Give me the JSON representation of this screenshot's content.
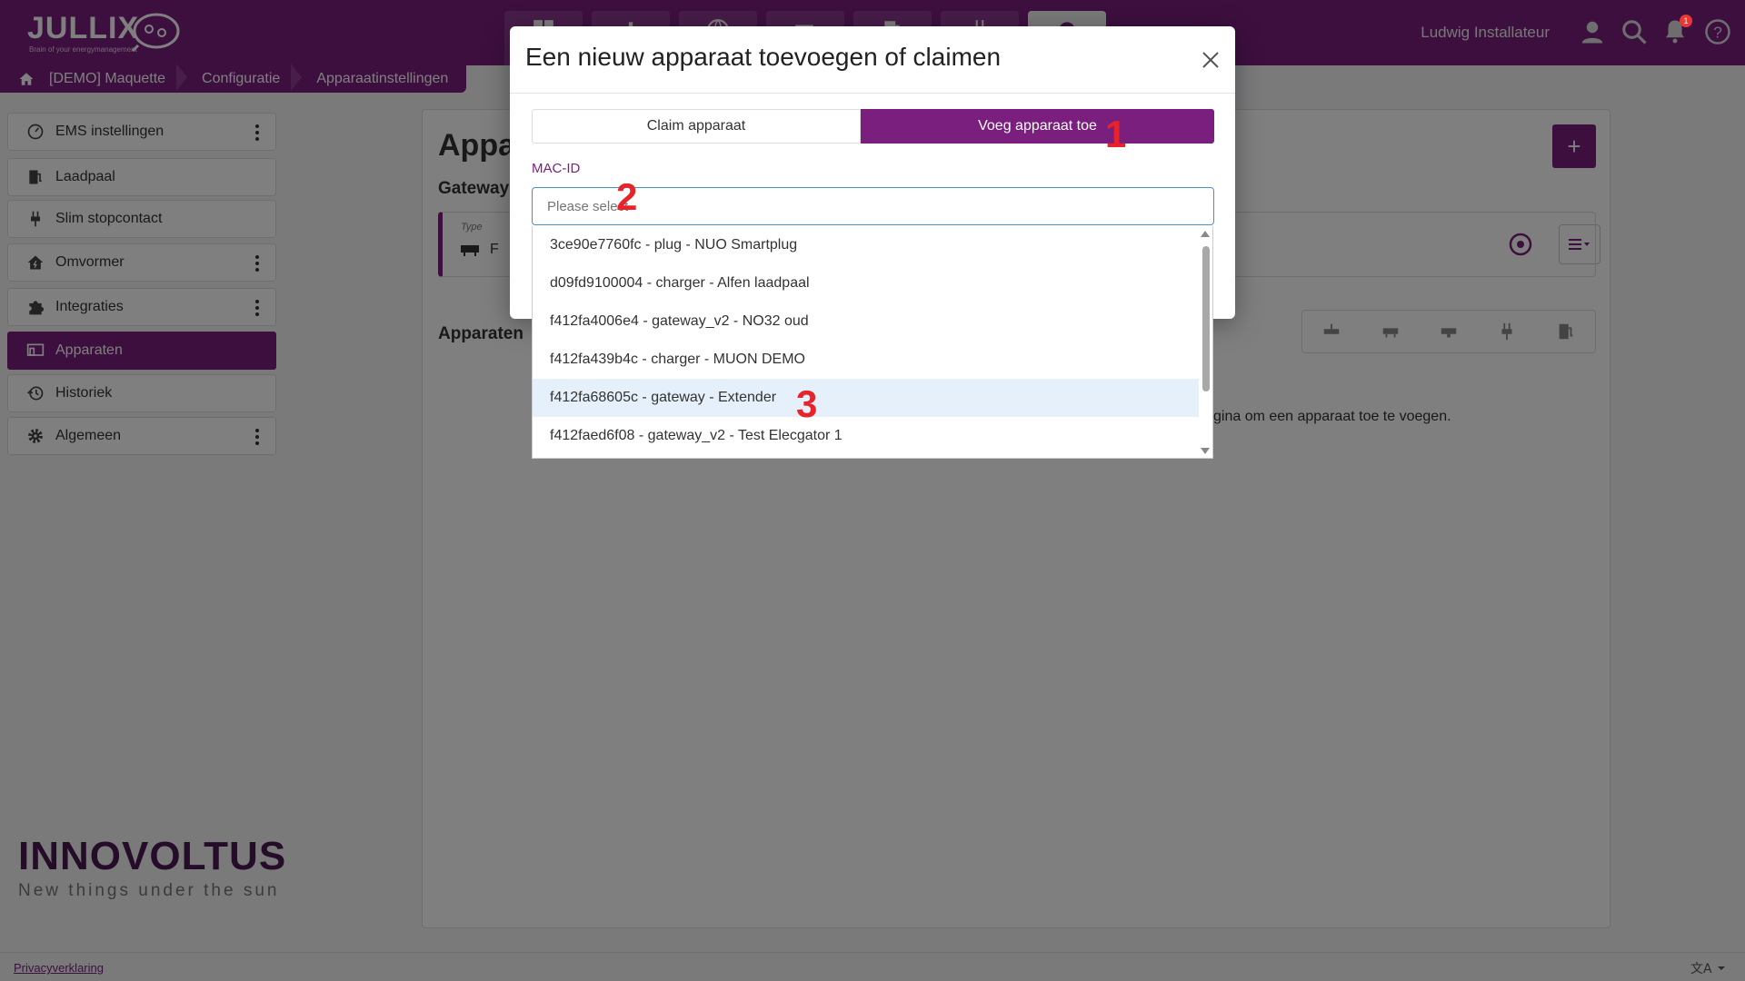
{
  "header": {
    "logo_text": "JULLIX",
    "logo_tagline": "Brain of your energymanagement",
    "user_name": "Ludwig Installateur",
    "notification_count": "1",
    "nav_tabs": [
      "dashboard-icon",
      "chart-icon",
      "globe-icon",
      "battery-icon",
      "charger-icon",
      "plug-icon",
      "settings-icon"
    ]
  },
  "breadcrumb": {
    "items": [
      "[DEMO] Maquette",
      "Configuratie",
      "Apparaatinstellingen"
    ]
  },
  "sidebar": {
    "items": [
      {
        "label": "EMS instellingen",
        "icon": "gauge-icon",
        "menu": true
      },
      {
        "label": "Laadpaal",
        "icon": "charger-icon",
        "menu": false
      },
      {
        "label": "Slim stopcontact",
        "icon": "plug-icon",
        "menu": false
      },
      {
        "label": "Omvormer",
        "icon": "house-bolt-icon",
        "menu": true
      },
      {
        "label": "Integraties",
        "icon": "puzzle-icon",
        "menu": true
      },
      {
        "label": "Apparaten",
        "icon": "devices-icon",
        "menu": false,
        "active": true
      },
      {
        "label": "Historiek",
        "icon": "history-icon",
        "menu": false
      },
      {
        "label": "Algemeen",
        "icon": "gear-icon",
        "menu": true
      }
    ],
    "brand_name": "INNOVOLTUS",
    "brand_tagline": "New things under the sun"
  },
  "main": {
    "title": "Appar",
    "gateway_heading": "Gateway",
    "gateway_type_label": "Type",
    "gateway_type_value": "F",
    "devices_heading": "Apparaten",
    "empty_message": "gina om een apparaat toe te voegen."
  },
  "modal": {
    "title": "Een nieuw apparaat toevoegen of claimen",
    "tab_claim": "Claim apparaat",
    "tab_add": "Voeg apparaat toe",
    "active_tab": "Voeg apparaat toe",
    "field_label": "MAC-ID",
    "placeholder": "Please select"
  },
  "dropdown": {
    "options": [
      "3ce90e7760fc - plug - NUO Smartplug",
      "d09fd9100004 - charger - Alfen laadpaal",
      "f412fa4006e4 - gateway_v2 - NO32 oud",
      "f412fa439b4c - charger - MUON DEMO",
      "f412fa68605c - gateway - Extender",
      "f412faed6f08 - gateway_v2 - Test Elecgator 1"
    ],
    "highlighted": "f412fa68605c - gateway - Extender"
  },
  "annotations": {
    "step1": "1",
    "step2": "2",
    "step3": "3"
  },
  "footer": {
    "privacy": "Privacyverklaring"
  },
  "colors": {
    "brand": "#7a1f7e",
    "highlight": "#e5f0fa",
    "annotation": "#e8242a"
  }
}
